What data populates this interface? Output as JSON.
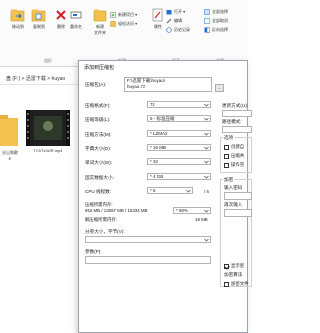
{
  "ribbon": {
    "move_to": "移动到",
    "copy_to": "复制到",
    "delete": "删除",
    "rename": "重命名",
    "new_folder_top": "新建",
    "new_folder_bottom": "文件夹",
    "new_item": "新建项目 ▾",
    "easy_access": "轻松访问 ▾",
    "properties": "属性",
    "open": "打开 ▾",
    "edit": "编辑",
    "history": "历史记录",
    "select_all": "全部选择",
    "select_none": "全部取消",
    "invert_selection": "反向选择",
    "group_organize": "组织",
    "group_new": "新建",
    "group_open": "打开",
    "group_select": "选择"
  },
  "address": {
    "path": "盘 (F:)  >  迅雷下载  >  huyao"
  },
  "files": {
    "folder_name_line1": "谷山和歌",
    "folder_name_line2": "E",
    "video_name": "TChTx3UR.mp4"
  },
  "dialog": {
    "title": "添加到压缩包",
    "archive_label": "压缩包(A):",
    "archive_path": "F:\\迅雷下载\\huyao\\",
    "archive_name": "huyao.7z",
    "browse_label": "...",
    "format_label": "压缩格式(F):",
    "format_value": "7z",
    "level_label": "压缩等级(L):",
    "level_value": "5 - 标准压缩",
    "method_label": "压缩方法(M):",
    "method_value": "* LZMA2",
    "dict_label": "字典大小(D):",
    "dict_value": "* 16 MB",
    "word_label": "单词大小(W):",
    "word_value": "* 32",
    "solid_label": "固实数据大小:",
    "solid_value": "* 4 GB",
    "cpu_label": "CPU 线程数:",
    "cpu_value": "* 6",
    "cpu_total": "/ 6",
    "mem_compress_label": "压缩所需内存:",
    "mem_compress_values": "952 MB / 13067 MB / 16334 MB",
    "mem_percent": "* 80%",
    "mem_decompress_label": "解压缩所需内存:",
    "mem_decompress_value": "18 MB",
    "split_label": "分卷大小，字节(V):",
    "params_label": "参数(P):",
    "update_mode_label": "更新方式(U):",
    "path_mode_label": "路径模式:",
    "options_label": "选项",
    "opt1": "创建自",
    "opt2": "压缩共",
    "opt3": "操作完",
    "encrypt_label": "加密",
    "password_label": "输入密码",
    "reenter_label": "再次输入",
    "show_password": "显示密",
    "encrypt_method": "加密算法",
    "encrypt_names": "加密文件"
  }
}
